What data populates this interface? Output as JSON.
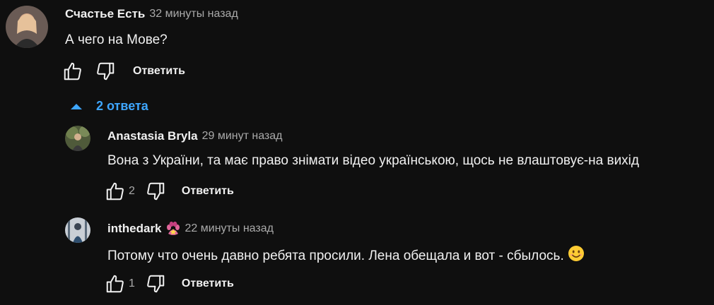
{
  "comment": {
    "author": "Счастье Есть",
    "time": "32 минуты назад",
    "text": "А чего на Мове?",
    "reply_label": "Ответить"
  },
  "replies_toggle": {
    "label": "2 ответа",
    "icon": "caret-up-icon",
    "color": "#3ea6ff"
  },
  "replies": [
    {
      "author": "Anastasia Bryla",
      "time": "29 минут назад",
      "text": "Вона з України, та має право знімати відео українською, щось не влаштовує-на вихід",
      "likes": "2",
      "reply_label": "Ответить"
    },
    {
      "author": "inthedark",
      "badge_icon": "paw-badge-icon",
      "time": "22 минуты назад",
      "text": "Потому что очень давно ребята просили. Лена обещала и вот - сбылось.",
      "emoji_icon": "smiling-face-emoji",
      "likes": "1",
      "reply_label": "Ответить"
    }
  ],
  "colors": {
    "background": "#0f0f0f",
    "text": "#f1f1f1",
    "secondary": "#aaaaaa",
    "link": "#3ea6ff"
  }
}
